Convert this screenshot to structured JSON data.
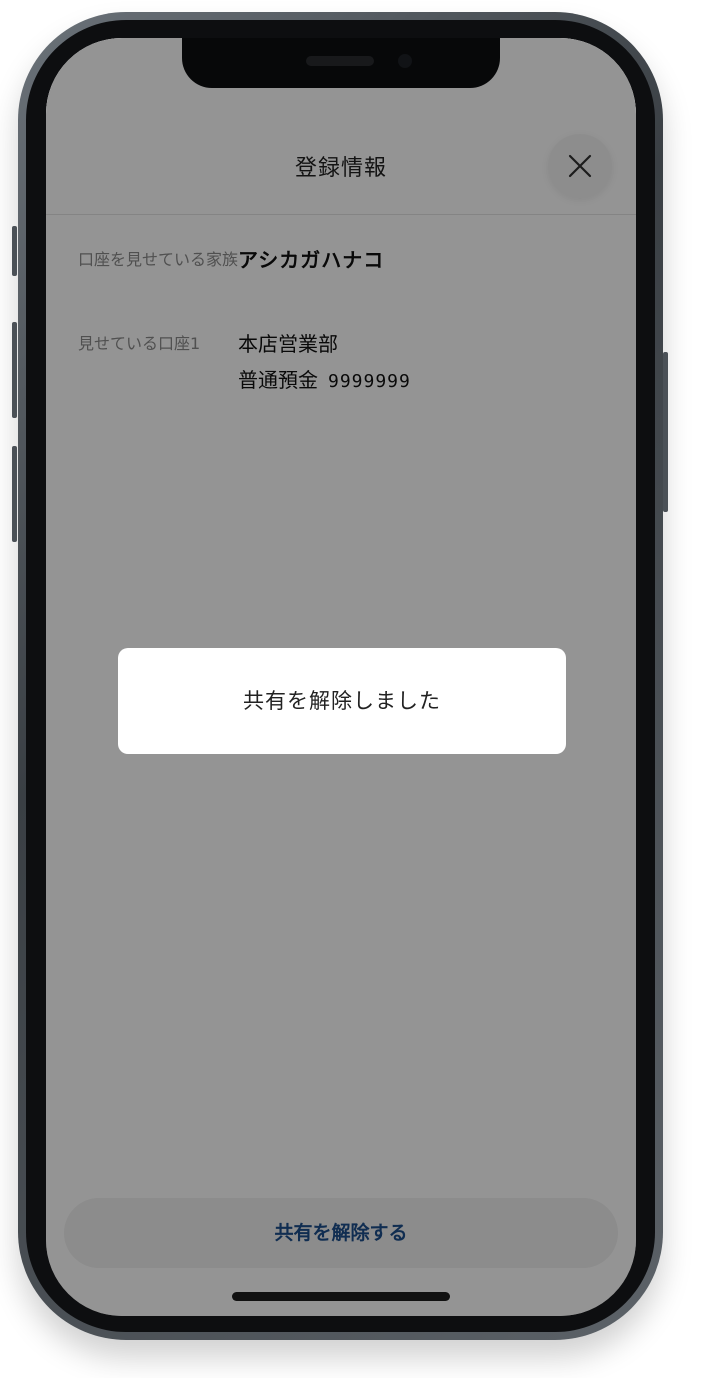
{
  "header": {
    "title": "登録情報",
    "close_icon": "close-x-icon"
  },
  "info": {
    "rows": [
      {
        "label": "口座を見せている家族",
        "value": "アシカガハナコ"
      },
      {
        "label": "見せている口座1",
        "branch": "本店営業部",
        "account_type": "普通預金",
        "account_number": "9999999"
      }
    ]
  },
  "footer": {
    "button_label": "共有を解除する",
    "button_color": "#1d4f8c"
  },
  "toast": {
    "message": "共有を解除しました"
  },
  "colors": {
    "overlay": "#000000",
    "accent": "#1d4f8c"
  }
}
